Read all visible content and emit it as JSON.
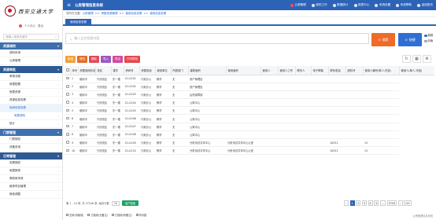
{
  "logo": {
    "text": "西安交通大学"
  },
  "user": {
    "role": "个人中心",
    "logout": "退出"
  },
  "sidebar": {
    "search_placeholder": "请输入菜单关键字",
    "groups": [
      {
        "title": "资源调剂",
        "items": [
          {
            "label": "调剂申请"
          },
          {
            "label": "公房管理"
          }
        ]
      },
      {
        "title": "资源审批",
        "items": [
          {
            "label": "审核流程"
          },
          {
            "label": "房屋配置"
          },
          {
            "label": "房屋资源"
          },
          {
            "label": "资源信息查看"
          },
          {
            "label": "使用信息查看"
          },
          {
            "label": "房屋调剂"
          },
          {
            "label": "统计"
          }
        ]
      },
      {
        "title": "门禁管理",
        "items": [
          {
            "label": "门禁授权"
          },
          {
            "label": "设备查询"
          }
        ]
      },
      {
        "title": "日常管理",
        "items": [
          {
            "label": "查看授权"
          },
          {
            "label": "房屋报修"
          },
          {
            "label": "周转房申请"
          },
          {
            "label": "维修项目管理"
          },
          {
            "label": "宿舍调整"
          }
        ]
      }
    ]
  },
  "topbar": {
    "title": "公房管理信息系统",
    "nav": [
      "公房管理",
      "我的工作",
      "数据统计",
      "报表中心",
      "系统设置",
      "系统帮助",
      "返回首页"
    ]
  },
  "crumb": {
    "prefix": "您所在位置:",
    "items": [
      "公房管理",
      "房屋资源管理",
      "使用信息查看",
      "使用信息查看"
    ]
  },
  "tab": {
    "label": "使用信息查看"
  },
  "search": {
    "placeholder": "输入全文检索内容",
    "search_btn": "搜索",
    "fast_btn": "快捷"
  },
  "radios": [
    {
      "label": "模糊",
      "on": true
    },
    {
      "label": "精确",
      "on": false
    }
  ],
  "toolbar": [
    {
      "label": "新增",
      "color": "#f0a13a"
    },
    {
      "label": "修改",
      "color": "#e06f2a"
    },
    {
      "label": "删除",
      "color": "#e14a59"
    },
    {
      "label": "导入",
      "color": "#9b59c0"
    },
    {
      "label": "导出",
      "color": "#d24aa0"
    },
    {
      "label": "打印预览",
      "color": "#e5484d"
    }
  ],
  "table": {
    "headers": [
      "",
      "序号",
      "房屋使用状态",
      "校区",
      "楼宇",
      "房间号",
      "房屋用途",
      "使用单位",
      "所属部门",
      "建筑面积",
      "使用面积",
      "使用人",
      "使用人工号",
      "联系人",
      "电子邮箱",
      "联系电话",
      "座机号",
      "使用人编号(单人,可选)",
      "使用人(单人,可选)"
    ],
    "rows": [
      [
        "1",
        "使用中",
        "兴庆校区",
        "东一楼",
        "01-0101",
        "行政办公",
        "教学",
        "无",
        "资产管理处",
        "",
        "",
        "",
        "",
        "",
        "",
        "",
        ""
      ],
      [
        "2",
        "使用中",
        "兴庆校区",
        "东一楼",
        "01-0102",
        "行政办公",
        "教学",
        "无",
        "资产管理处",
        "",
        "",
        "",
        "",
        "",
        "",
        "",
        ""
      ],
      [
        "3",
        "使用中",
        "兴庆校区",
        "东一楼",
        "01-0103",
        "行政办公",
        "教学",
        "无",
        "后勤保障部",
        "",
        "",
        "",
        "",
        "",
        "",
        "",
        ""
      ],
      [
        "4",
        "使用中",
        "兴庆校区",
        "东一楼",
        "01-0104",
        "行政办公",
        "教学",
        "无",
        "公寓中心",
        "",
        "",
        "",
        "",
        "",
        "",
        "",
        ""
      ],
      [
        "5",
        "使用中",
        "兴庆校区",
        "东一楼",
        "01-0105",
        "行政办公",
        "教学",
        "无",
        "公寓中心",
        "",
        "",
        "",
        "",
        "",
        "",
        "",
        ""
      ],
      [
        "6",
        "使用中",
        "兴庆校区",
        "东一楼",
        "01-0106",
        "行政办公",
        "教学",
        "无",
        "公寓中心",
        "",
        "",
        "",
        "",
        "",
        "",
        "",
        ""
      ],
      [
        "7",
        "使用中",
        "兴庆校区",
        "东一楼",
        "01-0107",
        "行政办公",
        "教学",
        "无",
        "公寓中心",
        "",
        "",
        "",
        "",
        "",
        "",
        "",
        ""
      ],
      [
        "8",
        "使用中",
        "兴庆校区",
        "东一楼",
        "01-0108",
        "行政办公",
        "教学",
        "无",
        "公寓中心",
        "",
        "",
        "",
        "",
        "",
        "",
        "",
        ""
      ],
      [
        "9",
        "使用中",
        "兴庆校区",
        "东一楼",
        "01-0109",
        "行政办公",
        "教学",
        "无",
        "分析测试共享中心",
        "分析测试共享中心公室",
        "",
        "",
        "",
        "",
        "18251",
        "",
        "15"
      ],
      [
        "10",
        "使用中",
        "兴庆校区",
        "东一楼",
        "01-0110",
        "行政办公",
        "教学",
        "无",
        "分析测试共享中心",
        "分析测试共享中心公室",
        "",
        "",
        "",
        "",
        "18251",
        "",
        "15"
      ]
    ]
  },
  "pager": {
    "info": "第 1 - 10 条, 共 37546 条, 每页行数",
    "size": "10",
    "export_btn": "用户检索",
    "pages": [
      "‹",
      "1",
      "2",
      "3",
      "4",
      "5",
      "...",
      "3755",
      "›"
    ],
    "goto": "GO"
  },
  "legend": [
    {
      "label": "空闲(待使用)"
    },
    {
      "label": "已使用(无备注)"
    },
    {
      "label": "已使用(有备注)"
    },
    {
      "label": "有问题"
    }
  ],
  "footer": {
    "text": "公房管理信息系统"
  }
}
